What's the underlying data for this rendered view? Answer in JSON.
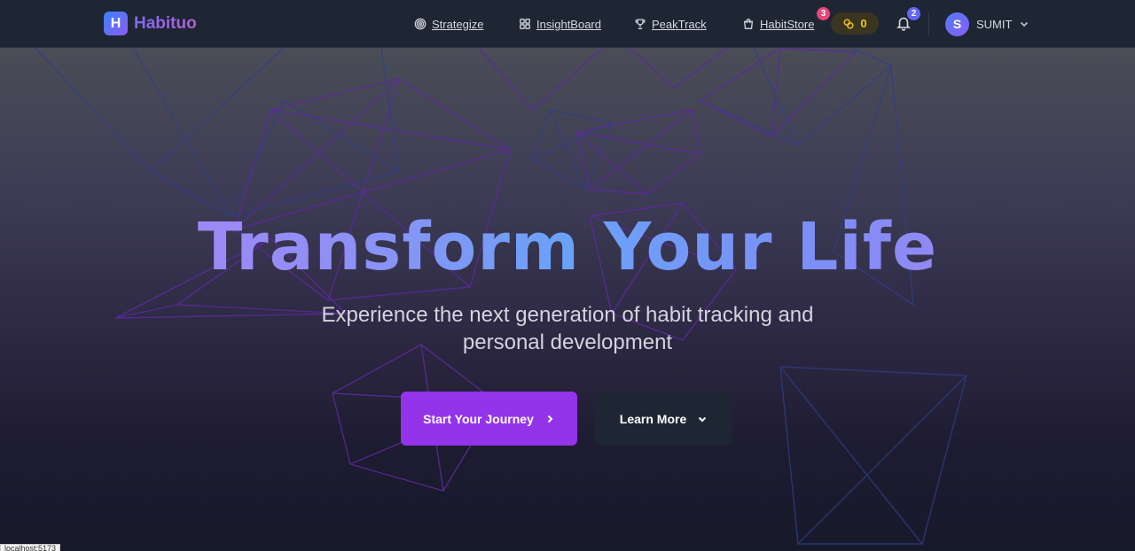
{
  "brand": {
    "logo_letter": "H",
    "name": "Habituo"
  },
  "nav": {
    "links": [
      {
        "label": "Strategize",
        "icon": "target-icon"
      },
      {
        "label": "InsightBoard",
        "icon": "grid-icon"
      },
      {
        "label": "PeakTrack",
        "icon": "trophy-icon"
      },
      {
        "label": "HabitStore",
        "icon": "shopping-bag-icon"
      }
    ],
    "store_badge": "3",
    "coins": "0",
    "notifications_badge": "2",
    "user": {
      "initial": "S",
      "name": "SUMIT"
    }
  },
  "hero": {
    "title": "Transform Your Life",
    "subtitle_line1": "Experience the next generation of habit tracking and",
    "subtitle_line2": "personal development",
    "primary_button": "Start Your Journey",
    "secondary_button": "Learn More"
  },
  "status_bar": {
    "url": "localhost:5173"
  },
  "colors": {
    "accent": "#9333ea",
    "navbar_bg": "#1e2533",
    "coin": "#f2c418",
    "store_badge": "#e8457a",
    "notification_badge": "#6366f1"
  }
}
